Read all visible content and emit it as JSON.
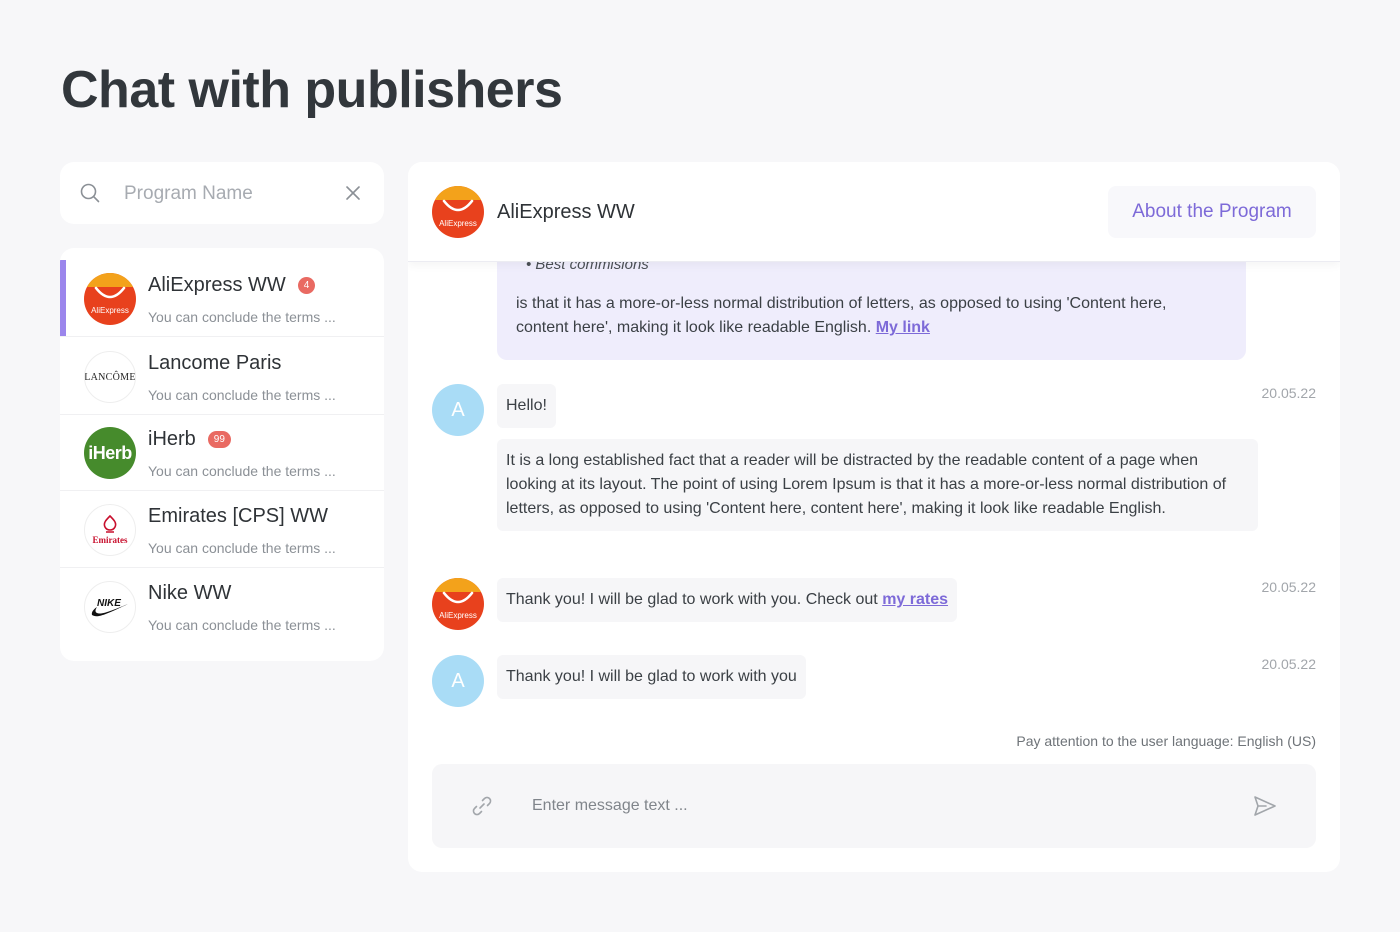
{
  "page": {
    "title": "Chat with publishers"
  },
  "search": {
    "placeholder": "Program Name",
    "value": ""
  },
  "programs": [
    {
      "name": "AliExpress WW",
      "badge": "4",
      "preview": "You can conclude the terms ...",
      "logo": "aliexpress-logo",
      "logo_text": "AliExpress"
    },
    {
      "name": "Lancome Paris",
      "badge": "",
      "preview": "You can conclude the terms ...",
      "logo": "lancome-logo",
      "logo_text": "LANCÔME"
    },
    {
      "name": "iHerb",
      "badge": "99",
      "preview": "You can conclude the terms ...",
      "logo": "iherb-logo",
      "logo_text": "iHerb"
    },
    {
      "name": "Emirates [CPS] WW",
      "badge": "",
      "preview": "You can conclude the terms ...",
      "logo": "emirates-logo",
      "logo_text": "Emirates"
    },
    {
      "name": "Nike WW",
      "badge": "",
      "preview": "You can conclude the terms ...",
      "logo": "nike-logo",
      "logo_text": "NIKE"
    }
  ],
  "chat": {
    "title": "AliExpress WW",
    "about_label": "About the Program",
    "highlight": {
      "bullet": "Best commisions",
      "body": "is that it has a more-or-less normal distribution of letters, as opposed to using 'Content here, content here', making it look like readable English.",
      "link": "My link"
    },
    "messages": [
      {
        "avatar": "A",
        "text": "Hello!",
        "time": "20.05.22"
      },
      {
        "text": "It is a long established fact that a reader will be distracted by the readable content of a page when looking at its layout. The point of using Lorem Ipsum is that it has a more-or-less normal distribution of letters, as opposed to using 'Content here, content here', making it look like readable English."
      },
      {
        "text": "Thank you! I will be glad to work with you. Check out",
        "link": "my rates",
        "time": "20.05.22"
      },
      {
        "avatar": "A",
        "text": "Thank you! I will be glad to work with you",
        "time": "20.05.22"
      }
    ],
    "language_note": "Pay attention to the user language: English (US)",
    "composer_placeholder": "Enter message text ..."
  },
  "colors": {
    "accent": "#7d6ad8",
    "active_bar": "#9b86ec",
    "highlight_bg": "#efedfc",
    "badge": "#e96a62",
    "avatar_a": "#a9dcf6"
  }
}
